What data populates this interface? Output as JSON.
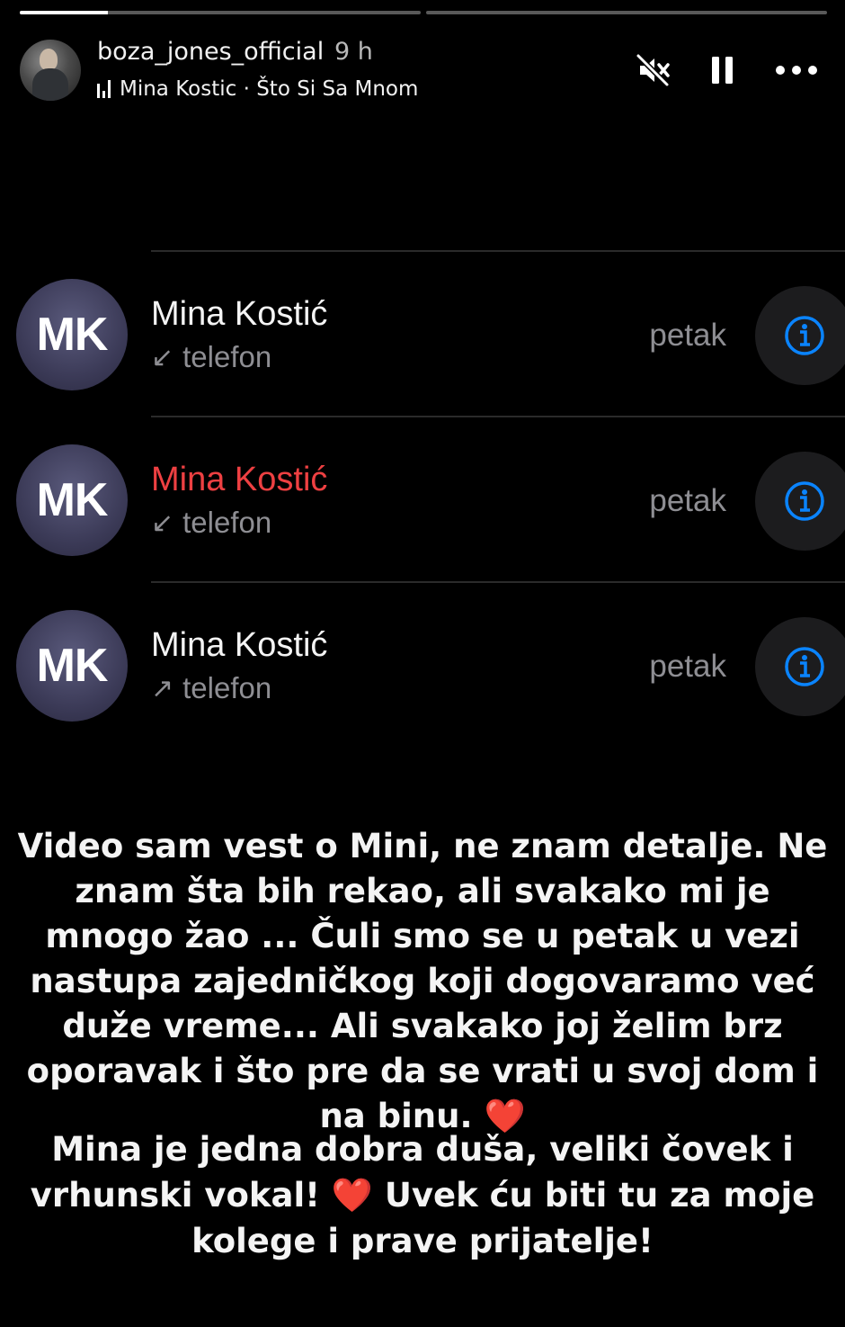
{
  "progress": {
    "segments": 2,
    "active_segment_fill": 0.22
  },
  "story": {
    "username": "boza_jones_official",
    "time_ago": "9 h",
    "music_label": "Mina Kostic · Što Si Sa Mnom",
    "controls": {
      "mute_icon": "speaker-muted-icon",
      "pause_icon": "pause-icon",
      "more_icon": "more-dots-icon"
    }
  },
  "calls": [
    {
      "initials": "MK",
      "name": "Mina Kostić",
      "missed": false,
      "direction_icon": "↙",
      "type": "telefon",
      "day": "petak",
      "info_icon": "info-icon"
    },
    {
      "initials": "MK",
      "name": "Mina Kostić",
      "missed": true,
      "direction_icon": "↙",
      "type": "telefon",
      "day": "petak",
      "info_icon": "info-icon"
    },
    {
      "initials": "MK",
      "name": "Mina Kostić",
      "missed": false,
      "direction_icon": "↗",
      "type": "telefon",
      "day": "petak",
      "info_icon": "info-icon"
    }
  ],
  "colors": {
    "missed": "#ee4042",
    "info_accent": "#0a84ff",
    "secondary_text": "#8e8e93",
    "heart": "#e8131f"
  },
  "message": {
    "paragraph1": "Video sam vest o Mini, ne znam detalje. Ne znam šta bih rekao, ali svakako mi je mnogo žao ... Čuli smo se u petak u vezi nastupa zajedničkog koji dogovaramo već duže vreme... Ali svakako joj želim brz oporavak i što pre da se vrati u svoj dom i na binu.",
    "heart1": "❤️",
    "paragraph2_part1": "Mina je jedna dobra duša, veliki čovek i vrhunski vokal!",
    "heart2": "❤️",
    "paragraph2_part2": "Uvek ću biti tu za moje kolege i prave prijatelje!"
  }
}
